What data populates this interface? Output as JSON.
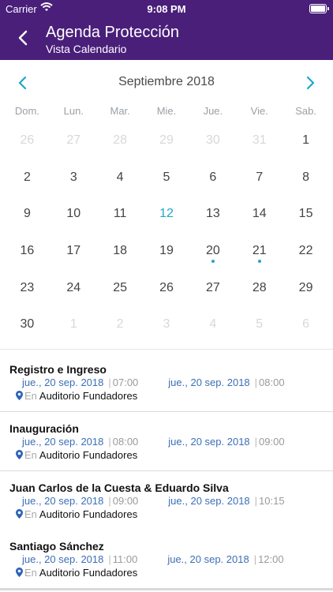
{
  "status_bar": {
    "carrier": "Carrier",
    "time": "9:08 PM"
  },
  "header": {
    "title": "Agenda Protección",
    "subtitle": "Vista Calendario",
    "back_icon": "chevron-left-icon"
  },
  "calendar": {
    "month_label": "Septiembre 2018",
    "prev_icon": "chevron-left-icon",
    "next_icon": "chevron-right-icon",
    "weekdays": [
      "Dom.",
      "Lun.",
      "Mar.",
      "Mie.",
      "Jue.",
      "Vie.",
      "Sab."
    ],
    "days": [
      {
        "d": "26",
        "out": true
      },
      {
        "d": "27",
        "out": true
      },
      {
        "d": "28",
        "out": true
      },
      {
        "d": "29",
        "out": true
      },
      {
        "d": "30",
        "out": true
      },
      {
        "d": "31",
        "out": true
      },
      {
        "d": "1"
      },
      {
        "d": "2"
      },
      {
        "d": "3"
      },
      {
        "d": "4"
      },
      {
        "d": "5"
      },
      {
        "d": "6"
      },
      {
        "d": "7"
      },
      {
        "d": "8"
      },
      {
        "d": "9"
      },
      {
        "d": "10"
      },
      {
        "d": "11"
      },
      {
        "d": "12",
        "today": true
      },
      {
        "d": "13"
      },
      {
        "d": "14"
      },
      {
        "d": "15"
      },
      {
        "d": "16"
      },
      {
        "d": "17"
      },
      {
        "d": "18"
      },
      {
        "d": "19"
      },
      {
        "d": "20",
        "event": true
      },
      {
        "d": "21",
        "event": true
      },
      {
        "d": "22"
      },
      {
        "d": "23"
      },
      {
        "d": "24"
      },
      {
        "d": "25"
      },
      {
        "d": "26"
      },
      {
        "d": "27"
      },
      {
        "d": "28"
      },
      {
        "d": "29"
      },
      {
        "d": "30"
      },
      {
        "d": "1",
        "out": true
      },
      {
        "d": "2",
        "out": true
      },
      {
        "d": "3",
        "out": true
      },
      {
        "d": "4",
        "out": true
      },
      {
        "d": "5",
        "out": true
      },
      {
        "d": "6",
        "out": true
      }
    ],
    "accent_color": "#1fa7c9"
  },
  "events": [
    {
      "name": "Registro e Ingreso",
      "start_date": "jue., 20 sep. 2018",
      "start_time": "07:00",
      "end_date": "jue., 20 sep. 2018",
      "end_time": "08:00",
      "location_prefix": "En",
      "location": "Auditorio Fundadores"
    },
    {
      "name": "Inauguración",
      "start_date": "jue., 20 sep. 2018",
      "start_time": "08:00",
      "end_date": "jue., 20 sep. 2018",
      "end_time": "09:00",
      "location_prefix": "En",
      "location": "Auditorio Fundadores"
    },
    {
      "name": "Juan Carlos de la Cuesta & Eduardo Silva",
      "start_date": "jue., 20 sep. 2018",
      "start_time": "09:00",
      "end_date": "jue., 20 sep. 2018",
      "end_time": "10:15",
      "location_prefix": "En",
      "location": "Auditorio Fundadores"
    },
    {
      "name": "Santiago Sánchez",
      "start_date": "jue., 20 sep. 2018",
      "start_time": "11:00",
      "end_date": "jue., 20 sep. 2018",
      "end_time": "12:00",
      "location_prefix": "En",
      "location": "Auditorio Fundadores"
    }
  ],
  "colors": {
    "header_bg": "#4a1f7a",
    "date_text": "#3b6fb6"
  }
}
